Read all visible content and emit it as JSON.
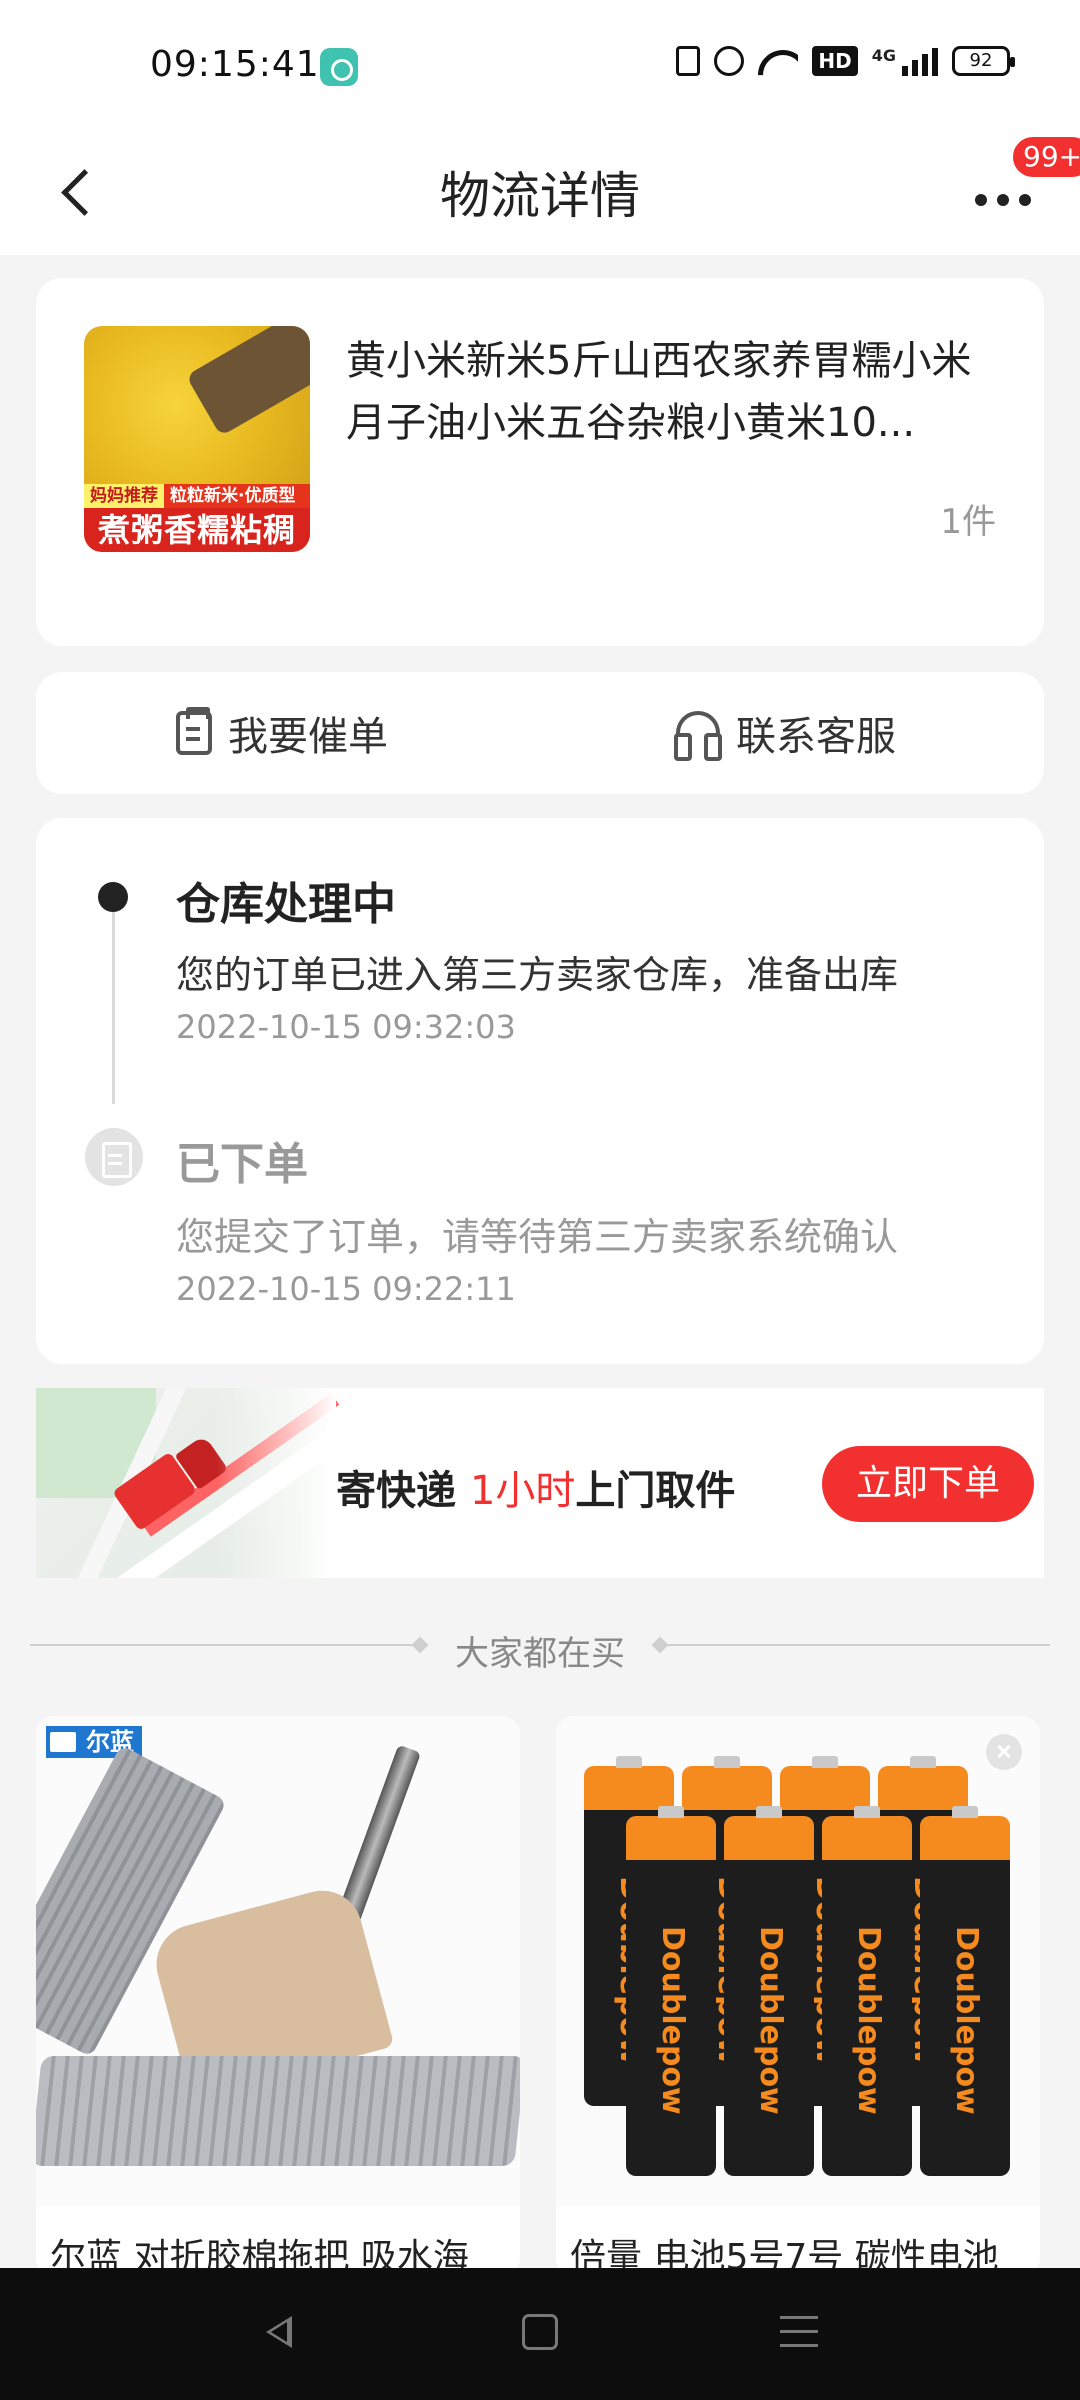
{
  "status_bar": {
    "time": "09:15:41",
    "hd_label": "HD",
    "network_label": "4G",
    "battery_level": "92"
  },
  "header": {
    "title": "物流详情",
    "badge": "99+"
  },
  "product": {
    "name": "黄小米新米5斤山西农家养胃糯小米月子油小米五谷杂粮小黄米10...",
    "quantity": "1件",
    "thumb_tag_left": "妈妈推荐",
    "thumb_tag_right": "粒粒新米·优质型",
    "thumb_banner": "煮粥香糯粘稠"
  },
  "actions": {
    "urge_label": "我要催单",
    "service_label": "联系客服"
  },
  "timeline": [
    {
      "title": "仓库处理中",
      "desc": "您的订单已进入第三方卖家仓库，准备出库",
      "time": "2022-10-15 09:32:03"
    },
    {
      "title": "已下单",
      "desc": "您提交了订单，请等待第三方卖家系统确认",
      "time": "2022-10-15 09:22:11"
    }
  ],
  "promo": {
    "text_prefix": "寄快递 ",
    "text_highlight": "1小时",
    "text_suffix": "上门取件",
    "button_label": "立即下单",
    "accent_color": "#f23030"
  },
  "recommend": {
    "section_title": "大家都在买",
    "items": [
      {
        "name": "尔蓝 对折胶棉拖把 吸水海",
        "brand_logo": "尔蓝"
      },
      {
        "name": "倍量 电池5号7号 碳性电池"
      }
    ]
  }
}
